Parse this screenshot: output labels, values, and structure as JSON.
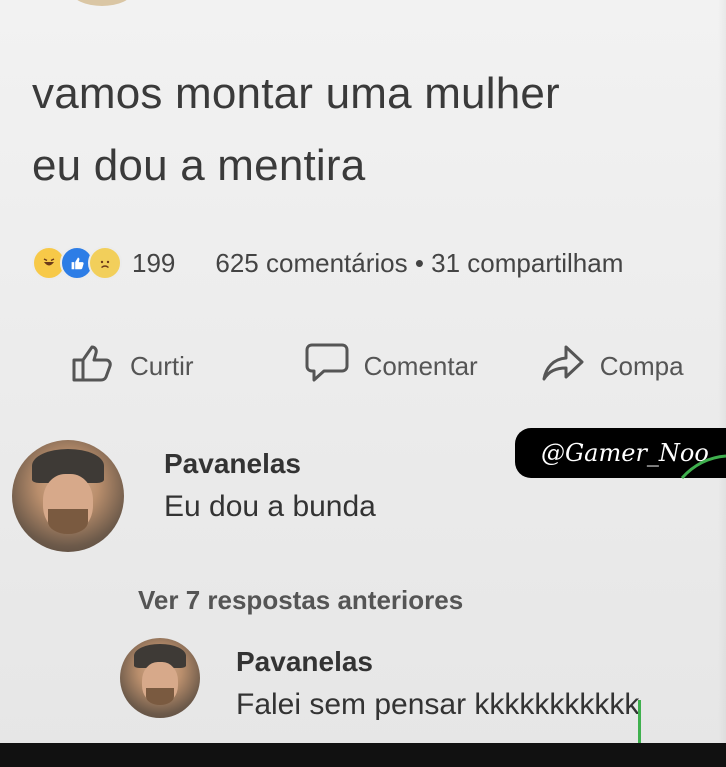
{
  "post": {
    "lines": [
      "vamos montar uma mulher",
      "eu dou a mentira"
    ]
  },
  "stats": {
    "reaction_icons": [
      "haha-icon",
      "like-icon",
      "sad-icon"
    ],
    "reaction_count": "199",
    "comments_shares": "625 comentários • 31 compartilham"
  },
  "actions": {
    "like_label": "Curtir",
    "comment_label": "Comentar",
    "share_label": "Compa"
  },
  "watermark": {
    "text": "@Gamer_Noo"
  },
  "comments": [
    {
      "author": "Pavanelas",
      "text": "Eu dou a bunda"
    },
    {
      "author": "Pavanelas",
      "text": "Falei sem pensar kkkkkkkkkkk"
    }
  ],
  "replies": {
    "more_label": "Ver 7 respostas anteriores"
  },
  "colors": {
    "background": "#ececec",
    "like_blue": "#2d7de6",
    "reaction_yellow": "#f7c948",
    "watermark_bg": "#000000",
    "cursor_green": "#3fb04e"
  }
}
